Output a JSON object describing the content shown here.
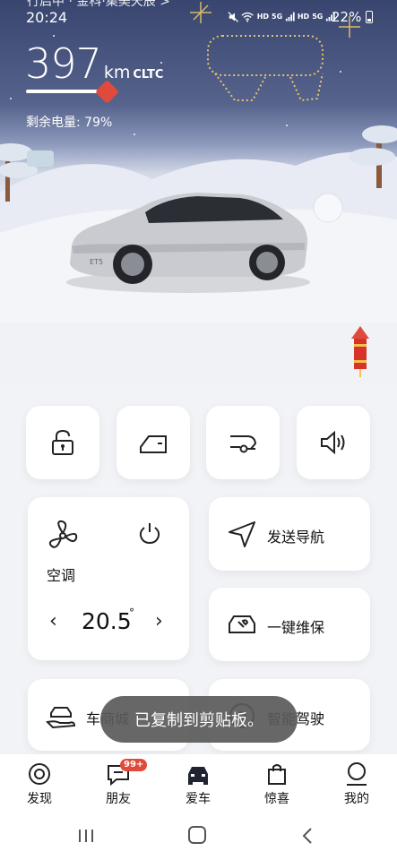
{
  "status_bar": {
    "location": "行启中 · 金科·集美天辰 >",
    "time": "20:24",
    "network_labels": [
      "HD",
      "5G",
      "HD",
      "5G"
    ],
    "battery": "22%"
  },
  "hero": {
    "range_value": "397",
    "range_unit": "km",
    "range_standard": "CLTC",
    "battery_label": "剩余电量: 79%",
    "car_model": "ET5"
  },
  "quick_controls": [
    {
      "name": "lock",
      "icon": "padlock-icon"
    },
    {
      "name": "door",
      "icon": "car-door-icon"
    },
    {
      "name": "trunk",
      "icon": "car-trunk-icon"
    },
    {
      "name": "horn",
      "icon": "speaker-icon"
    }
  ],
  "climate": {
    "label": "空调",
    "temperature": "20.5",
    "degree": "°"
  },
  "cards": {
    "navigation": "发送导航",
    "maintenance": "一键维保",
    "mall": "车商城",
    "smart_driving": "智能驾驶"
  },
  "toast": "已复制到剪贴板。",
  "tabs": [
    {
      "label": "发现",
      "icon": "discover-icon"
    },
    {
      "label": "朋友",
      "icon": "chat-icon",
      "badge": "99+"
    },
    {
      "label": "爱车",
      "icon": "car-icon",
      "active": true
    },
    {
      "label": "惊喜",
      "icon": "shopping-bag-icon"
    },
    {
      "label": "我的",
      "icon": "profile-icon"
    }
  ],
  "colors": {
    "accent_red": "#e04a3c",
    "sky_top": "#38456f"
  }
}
